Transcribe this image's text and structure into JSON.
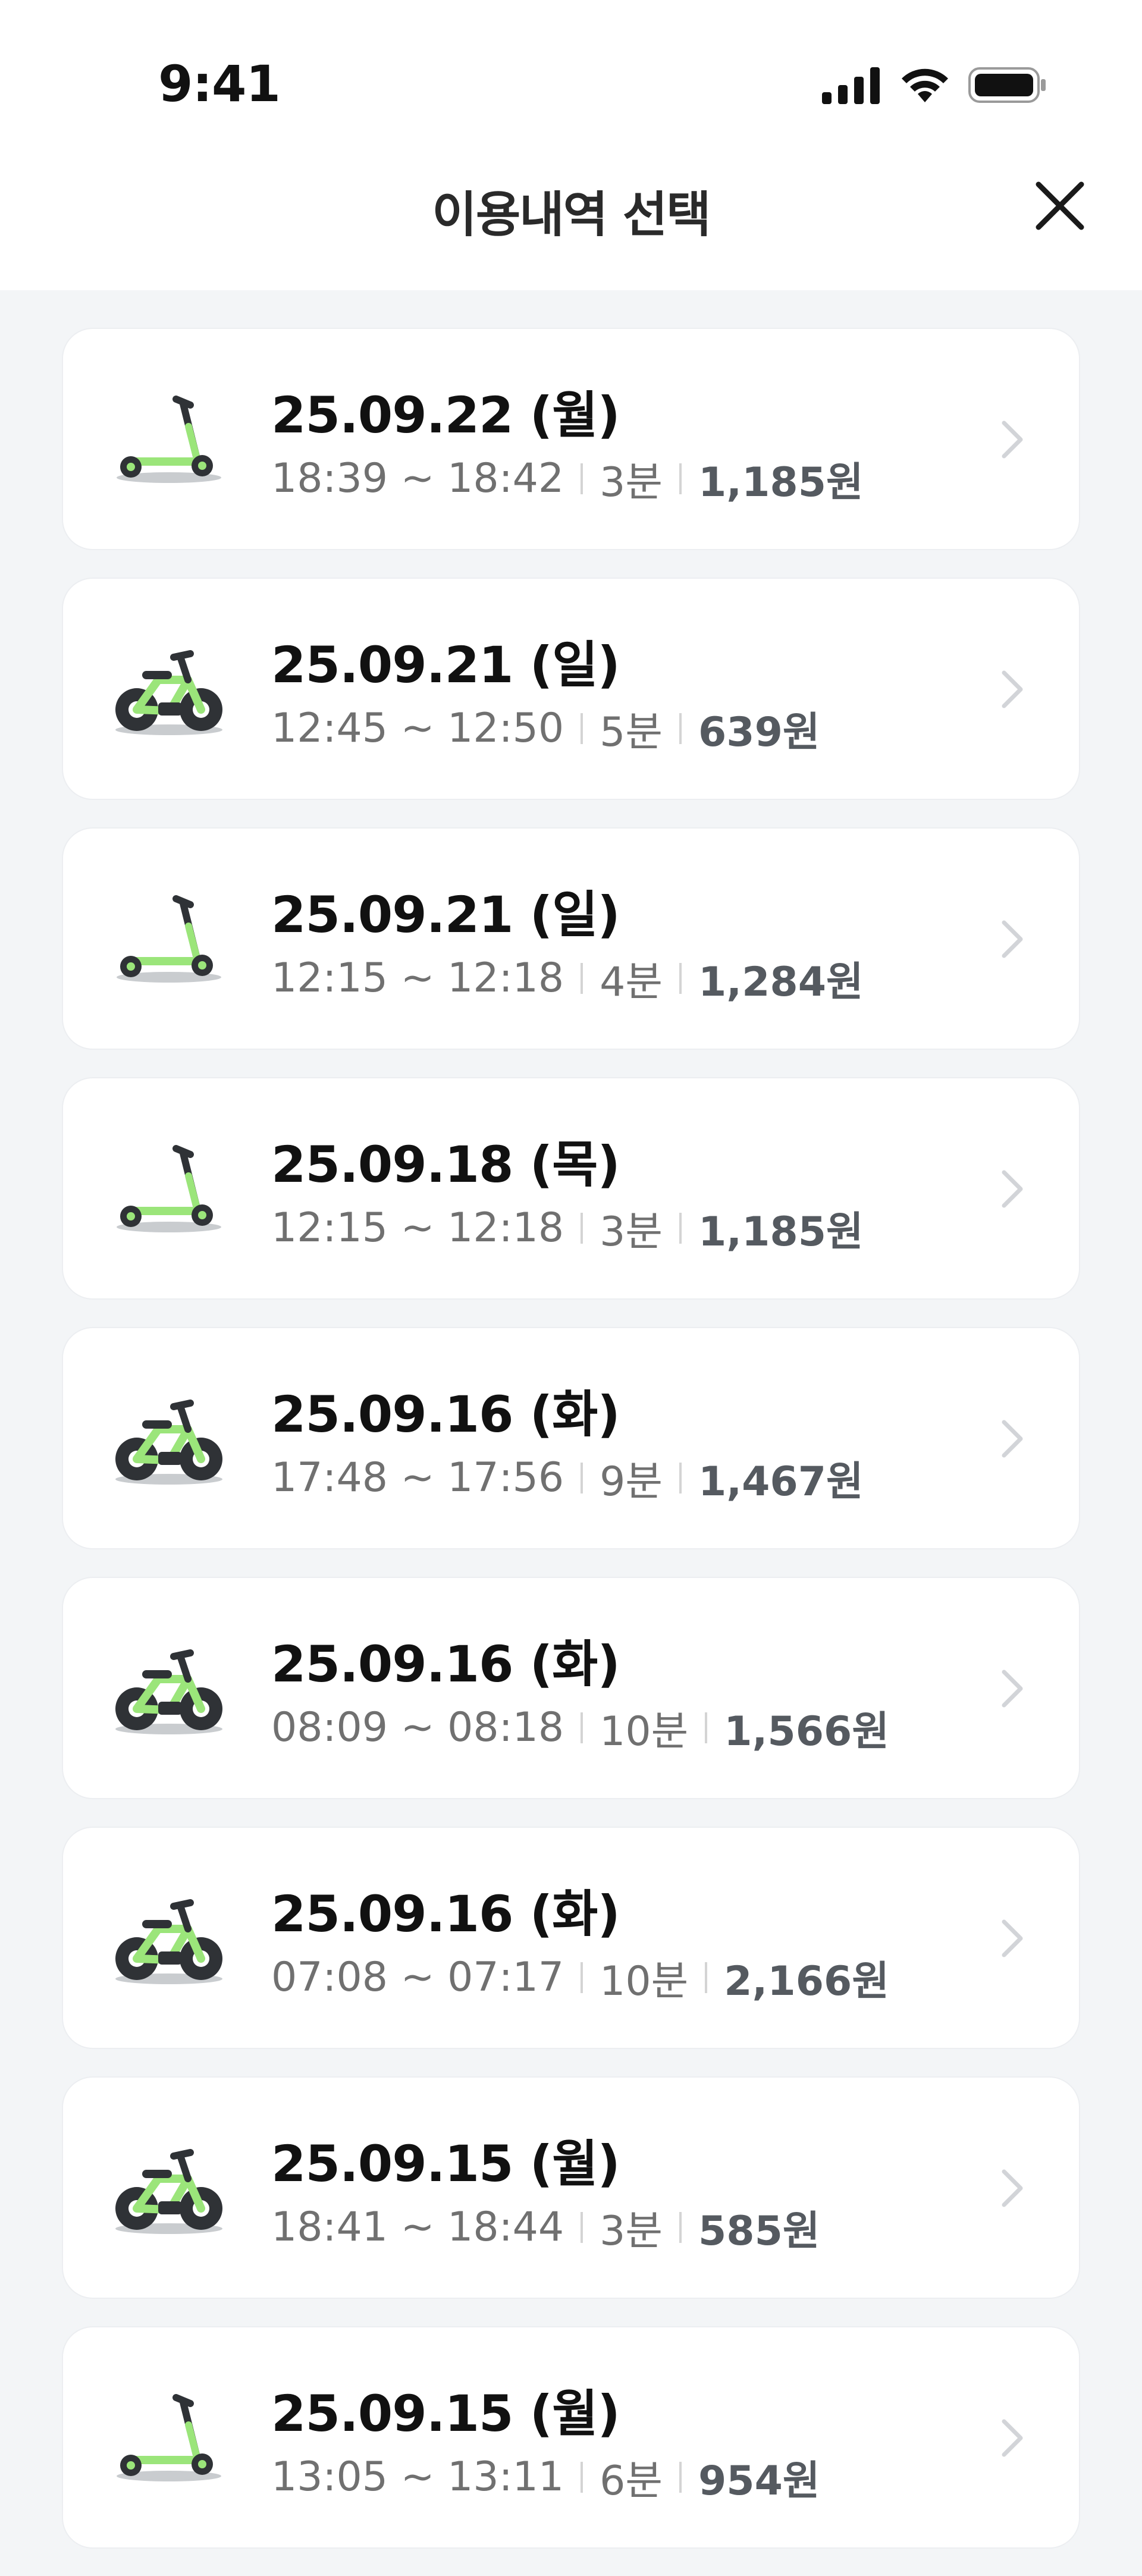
{
  "status_bar": {
    "time": "9:41",
    "icons": [
      "signal-icon",
      "wifi-icon",
      "battery-icon"
    ]
  },
  "header": {
    "title": "이용내역 선택",
    "close_icon": "close-icon"
  },
  "rides": [
    {
      "vehicle": "scooter-icon",
      "date": "25.09.22 (월)",
      "time": "18:39 ~ 18:42",
      "duration": "3분",
      "price": "1,185원"
    },
    {
      "vehicle": "bike-icon",
      "date": "25.09.21 (일)",
      "time": "12:45 ~ 12:50",
      "duration": "5분",
      "price": "639원"
    },
    {
      "vehicle": "scooter-icon",
      "date": "25.09.21 (일)",
      "time": "12:15 ~ 12:18",
      "duration": "4분",
      "price": "1,284원"
    },
    {
      "vehicle": "scooter-icon",
      "date": "25.09.18 (목)",
      "time": "12:15 ~ 12:18",
      "duration": "3분",
      "price": "1,185원"
    },
    {
      "vehicle": "bike-icon",
      "date": "25.09.16 (화)",
      "time": "17:48 ~ 17:56",
      "duration": "9분",
      "price": "1,467원"
    },
    {
      "vehicle": "bike-icon",
      "date": "25.09.16 (화)",
      "time": "08:09 ~ 08:18",
      "duration": "10분",
      "price": "1,566원"
    },
    {
      "vehicle": "bike-icon",
      "date": "25.09.16 (화)",
      "time": "07:08 ~ 07:17",
      "duration": "10분",
      "price": "2,166원"
    },
    {
      "vehicle": "bike-icon",
      "date": "25.09.15 (월)",
      "time": "18:41 ~ 18:44",
      "duration": "3분",
      "price": "585원"
    },
    {
      "vehicle": "scooter-icon",
      "date": "25.09.15 (월)",
      "time": "13:05 ~ 13:11",
      "duration": "6분",
      "price": "954원"
    }
  ],
  "colors": {
    "accent_green": "#9BE57A",
    "dark": "#2F3236",
    "background": "#F3F5F7",
    "card": "#FFFFFF"
  }
}
